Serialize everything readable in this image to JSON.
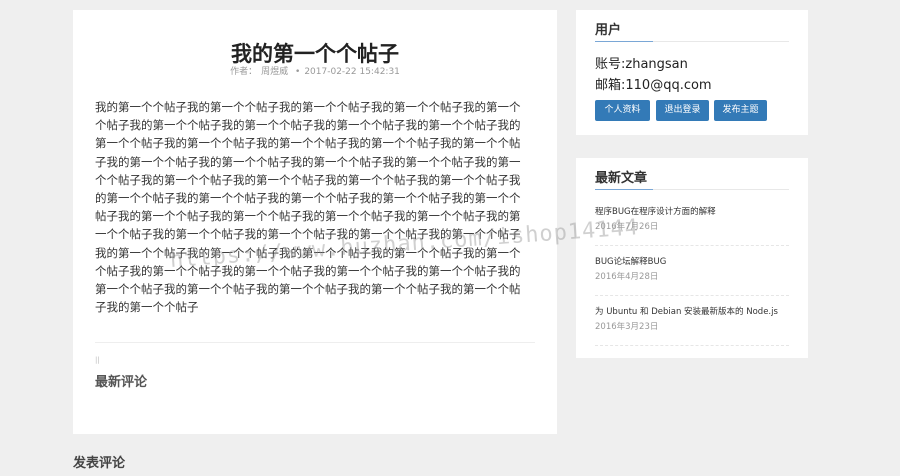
{
  "post": {
    "title": "我的第一个个帖子",
    "author_label": "作者：",
    "author": "周煜威",
    "bullet": "•",
    "date": "2017-02-22 15:42:31",
    "body": "我的第一个个帖子我的第一个个帖子我的第一个个帖子我的第一个个帖子我的第一个个帖子我的第一个个帖子我的第一个个帖子我的第一个个帖子我的第一个个帖子我的第一个个帖子我的第一个个帖子我的第一个个帖子我的第一个个帖子我的第一个个帖子我的第一个个帖子我的第一个个帖子我的第一个个帖子我的第一个个帖子我的第一个个帖子我的第一个个帖子我的第一个个帖子我的第一个个帖子我的第一个个帖子我的第一个个帖子我的第一个个帖子我的第一个个帖子我的第一个个帖子我的第一个个帖子我的第一个个帖子我的第一个个帖子我的第一个个帖子我的第一个个帖子我的第一个个帖子我的第一个个帖子我的第一个个帖子我的第一个个帖子我的第一个个帖子我的第一个个帖子我的第一个个帖子我的第一个个帖子我的第一个个帖子我的第一个个帖子我的第一个个帖子我的第一个个帖子我的第一个个帖子我的第一个个帖子我的第一个个帖子我的第一个个帖子我的第一个个帖子我的第一个个帖子我的第一个个帖子我的第一个个帖子",
    "comment_marker": "||",
    "comments_heading": "最新评论"
  },
  "user_panel": {
    "heading": "用户",
    "account": "账号:zhangsan",
    "email": "邮箱:110@qq.com",
    "buttons": {
      "profile": "个人资料",
      "logout": "退出登录",
      "new_topic": "发布主题"
    }
  },
  "articles_panel": {
    "heading": "最新文章",
    "items": [
      {
        "title": "程序BUG在程序设计方面的解释",
        "date": "2016年7月26日"
      },
      {
        "title": "BUG论坛解释BUG",
        "date": "2016年4月28日"
      },
      {
        "title": "为 Ubuntu 和 Debian 安装最新版本的 Node.js",
        "date": "2016年3月23日"
      }
    ]
  },
  "post_comment_heading": "发表评论",
  "watermark": "https://www.huzhan.com/ishop14144",
  "colors": {
    "page_bg": "#efefef",
    "button_bg": "#337ab7",
    "heading_accent": "#7aa7d6"
  }
}
